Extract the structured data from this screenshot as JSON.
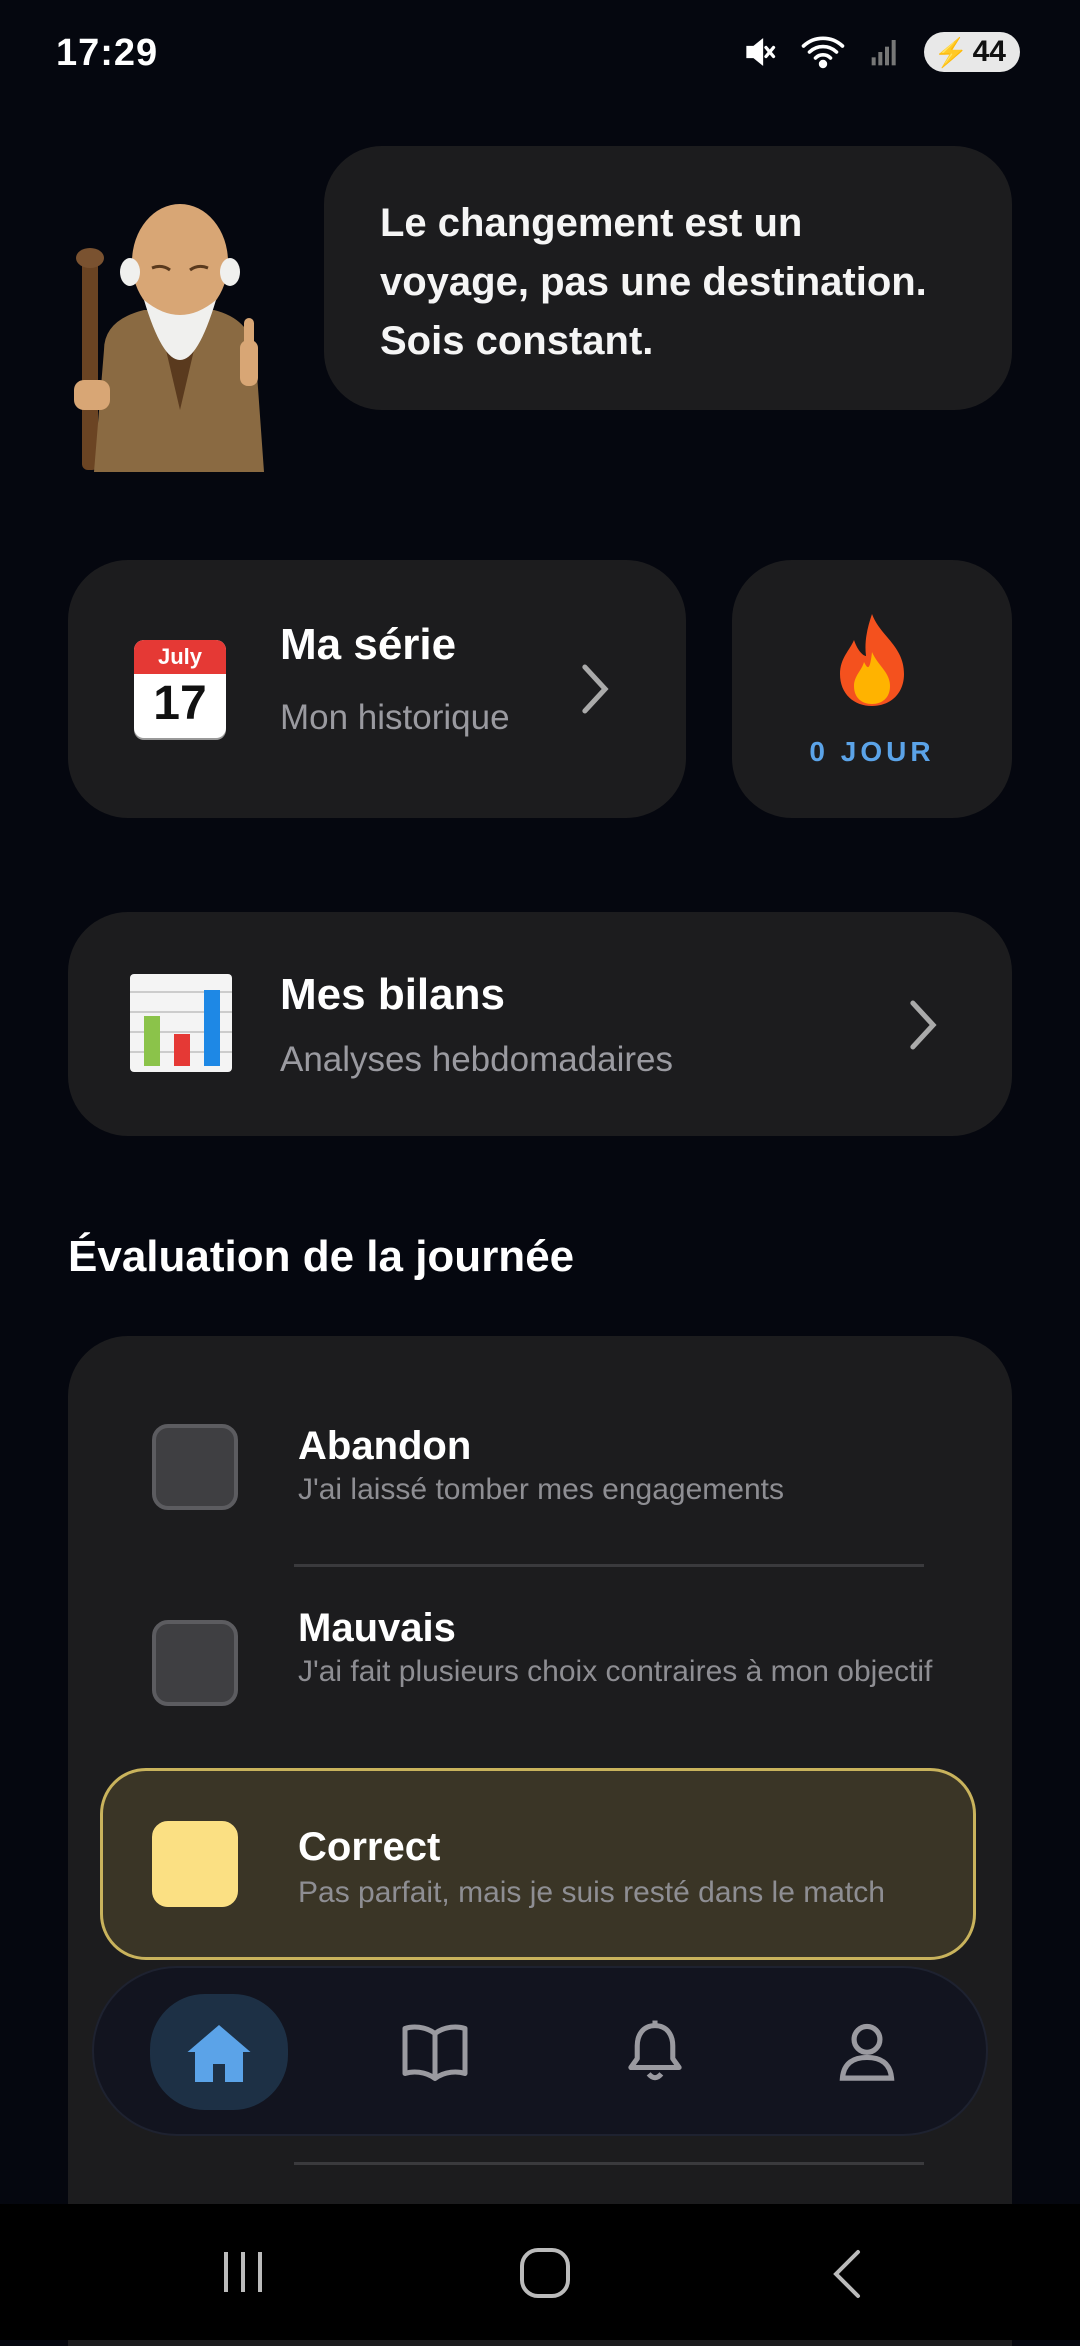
{
  "status_bar": {
    "time": "17:29",
    "battery": "44"
  },
  "quote": "Le changement est un voyage, pas une destination. Sois constant.",
  "serie_card": {
    "title": "Ma série",
    "subtitle": "Mon historique",
    "calendar_month": "July",
    "calendar_day": "17"
  },
  "streak_card": {
    "label": "0 JOUR"
  },
  "bilans_card": {
    "title": "Mes bilans",
    "subtitle": "Analyses hebdomadaires"
  },
  "evaluation": {
    "title": "Évaluation de la journée",
    "options": [
      {
        "title": "Abandon",
        "subtitle": "J'ai laissé tomber mes engagements",
        "selected": false
      },
      {
        "title": "Mauvais",
        "subtitle": "J'ai fait plusieurs choix contraires à mon objectif",
        "selected": false
      },
      {
        "title": "Correct",
        "subtitle": "Pas parfait, mais je suis resté dans le match",
        "selected": true
      }
    ]
  },
  "nav": {
    "items": [
      "home-icon",
      "book-icon",
      "bell-icon",
      "profile-icon"
    ],
    "active": "home-icon"
  },
  "colors": {
    "accent": "#5ba3e8",
    "selected_fill": "#fbe083",
    "selected_border": "#c9b35c"
  }
}
